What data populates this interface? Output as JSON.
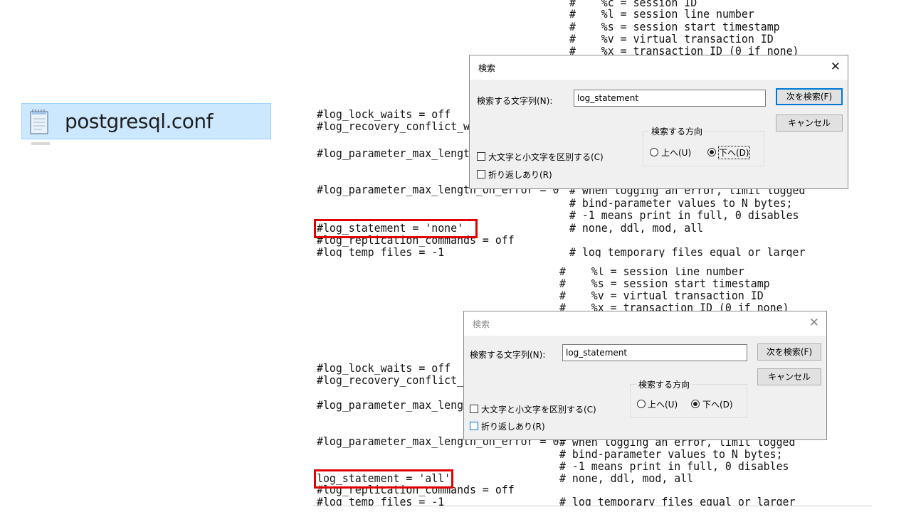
{
  "file": {
    "name": "postgresql.conf",
    "icon": "notepad-file-icon"
  },
  "top_pane": {
    "lines": [
      "#    %c = session ID",
      "#    %l = session line number",
      "#    %s = session start timestamp",
      "#    %v = virtual transaction ID",
      "#    %x = transaction ID (0 if none)",
      "#log_lock_waits = off",
      "#log_recovery_conflict_waits = off",
      "#log_parameter_max_length = -1",
      "#log_parameter_max_length_on_error = 0",
      "# when logging an error, limit logged",
      "# bind-parameter values to N bytes;",
      "# -1 means print in full, 0 disables",
      "#log_statement = 'none'",
      "# none, ddl, mod, all",
      "#log_replication_commands = off",
      "#log_temp_files = -1",
      "# log temporary files equal or larger"
    ]
  },
  "bottom_pane": {
    "lines": [
      "#    %l = session line number",
      "#    %s = session start timestamp",
      "#    %v = virtual transaction ID",
      "#    %x = transaction ID (0 if none)",
      "#log_lock_waits = off",
      "#log_recovery_conflict_waits = off",
      "#log_parameter_max_length = -1",
      "#log_parameter_max_length_on_error = 0",
      "# when logging an error, limit logged",
      "# bind-parameter values to N bytes;",
      "# -1 means print in full, 0 disables",
      "log_statement = 'all'",
      "# none, ddl, mod, all",
      "#log_replication_commands = off",
      "#log_temp_files = -1",
      "# log temporary files equal or larger"
    ]
  },
  "dialog": {
    "title": "検索",
    "search_label": "検索する文字列(N):",
    "search_value": "log_statement",
    "find_next": "次を検索(F)",
    "cancel": "キャンセル",
    "direction_legend": "検索する方向",
    "up": "上へ(U)",
    "down": "下へ(D)",
    "match_case": "大文字と小文字を区別する(C)",
    "wrap_around": "折り返しあり(R)",
    "direction_selected": "down"
  },
  "colors": {
    "highlight_box": "#e00000",
    "selected_tile": "#cce8ff",
    "dialog_bg": "#f0f0f0",
    "accent": "#0078d7"
  }
}
